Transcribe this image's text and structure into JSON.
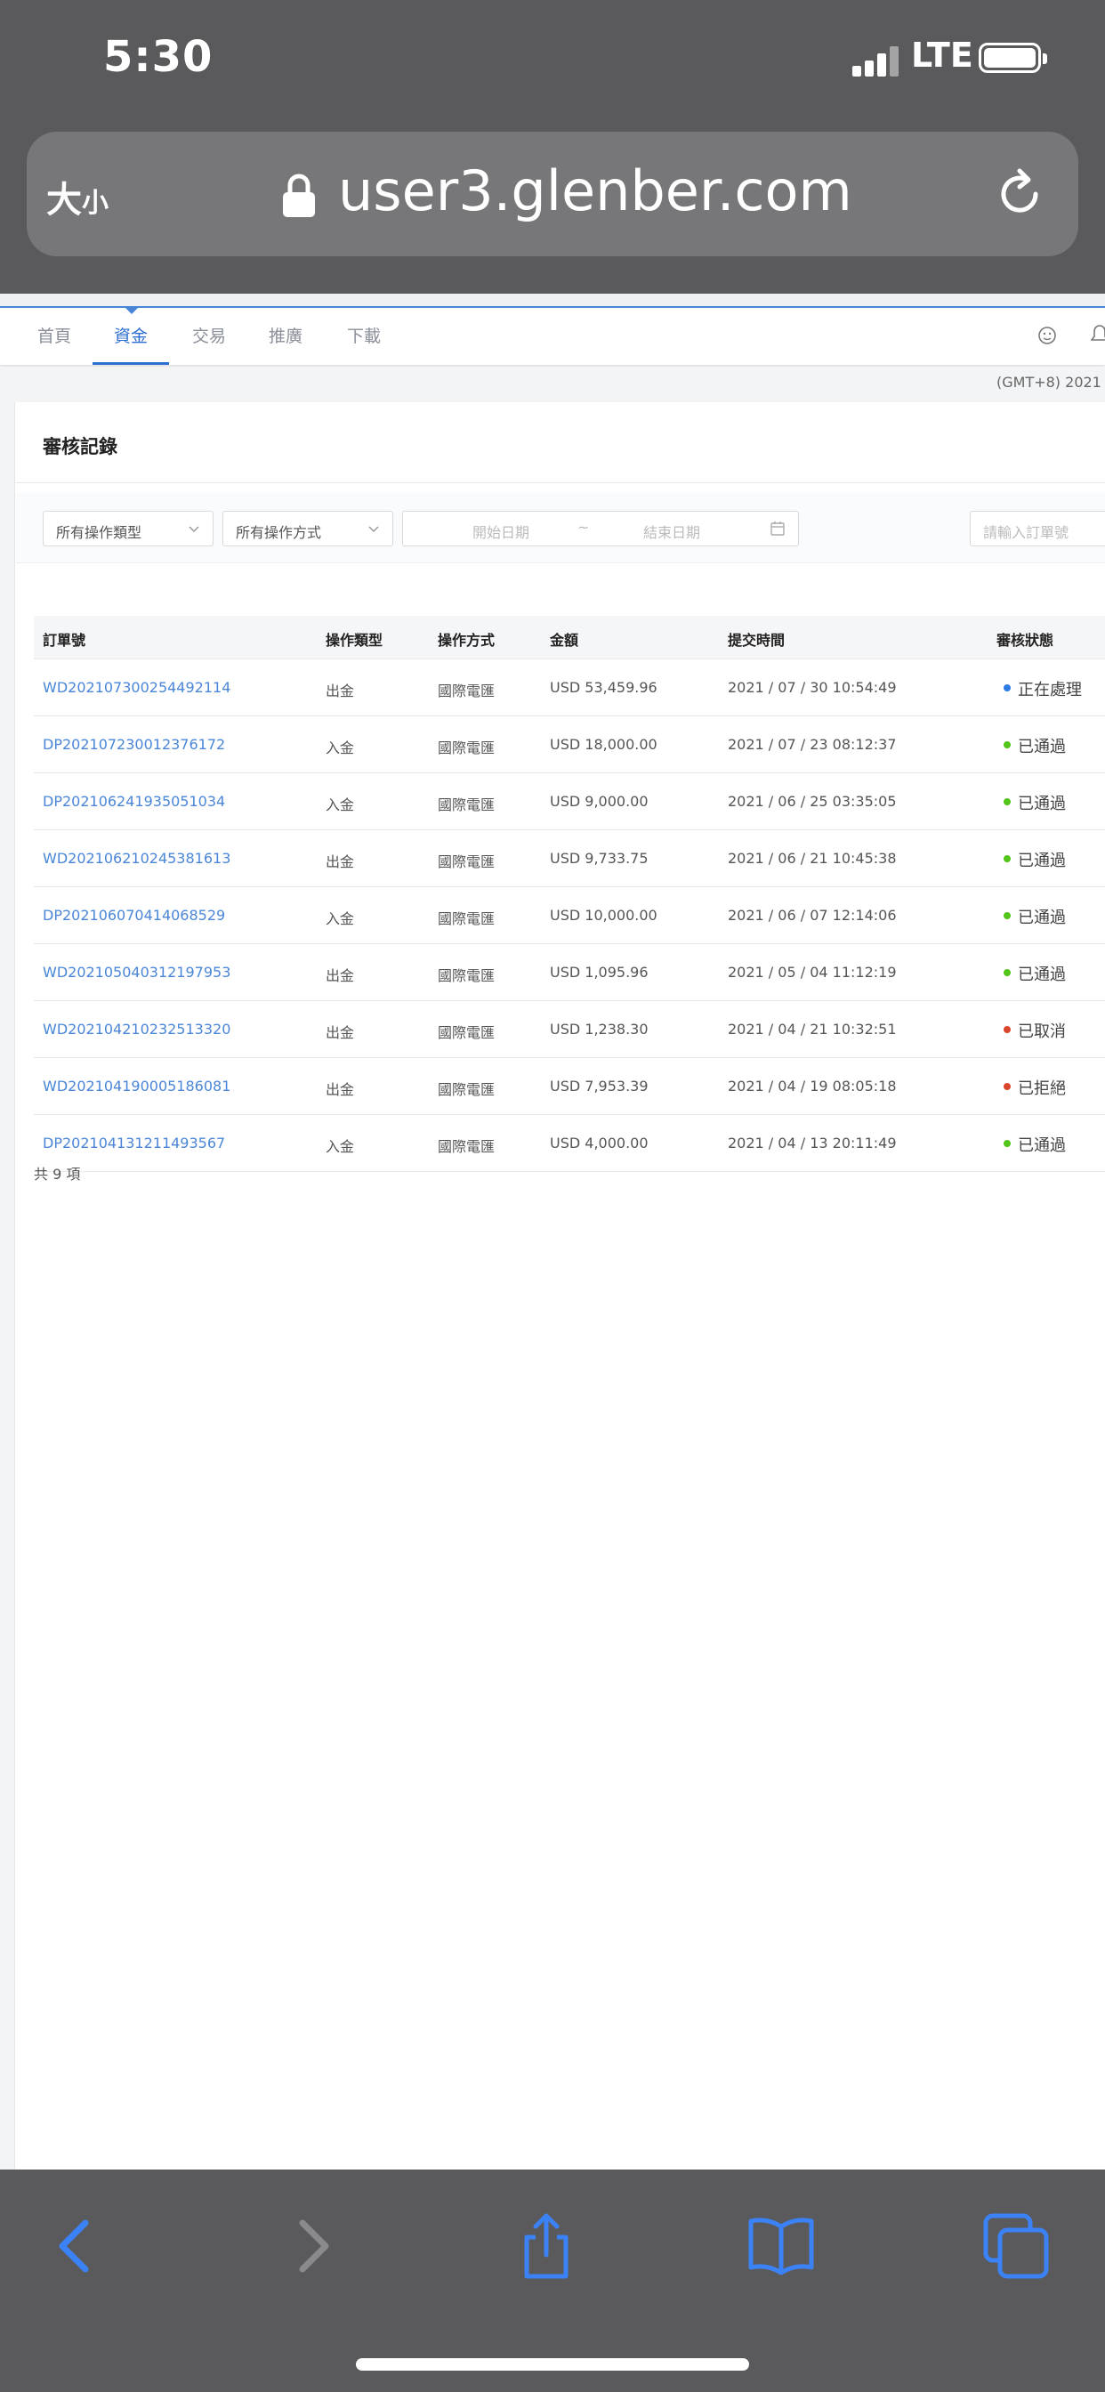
{
  "status_bar": {
    "time": "5:30",
    "network": "LTE"
  },
  "address_bar": {
    "text_size_big": "大",
    "text_size_small": "小",
    "domain": "user3.glenber.com"
  },
  "nav": {
    "tabs": [
      {
        "label": "首頁",
        "active": false
      },
      {
        "label": "資金",
        "active": true
      },
      {
        "label": "交易",
        "active": false
      },
      {
        "label": "推廣",
        "active": false
      },
      {
        "label": "下載",
        "active": false
      }
    ],
    "timezone": "(GMT+8) 2021 /"
  },
  "page": {
    "title": "審核記錄",
    "filters": {
      "type_select": "所有操作類型",
      "method_select": "所有操作方式",
      "start_date_placeholder": "開始日期",
      "date_separator": "~",
      "end_date_placeholder": "結束日期",
      "search_placeholder": "請輸入訂單號"
    },
    "table": {
      "headers": [
        "訂單號",
        "操作類型",
        "操作方式",
        "金額",
        "提交時間",
        "審核狀態"
      ],
      "rows": [
        {
          "order": "WD202107300254492114",
          "type": "出金",
          "method": "國際電匯",
          "amount": "USD 53,459.96",
          "time": "2021 / 07 / 30 10:54:49",
          "status": "正在處理",
          "status_color": "#2d7be5"
        },
        {
          "order": "DP202107230012376172",
          "type": "入金",
          "method": "國際電匯",
          "amount": "USD 18,000.00",
          "time": "2021 / 07 / 23 08:12:37",
          "status": "已通過",
          "status_color": "#52c41a"
        },
        {
          "order": "DP202106241935051034",
          "type": "入金",
          "method": "國際電匯",
          "amount": "USD 9,000.00",
          "time": "2021 / 06 / 25 03:35:05",
          "status": "已通過",
          "status_color": "#52c41a"
        },
        {
          "order": "WD202106210245381613",
          "type": "出金",
          "method": "國際電匯",
          "amount": "USD 9,733.75",
          "time": "2021 / 06 / 21 10:45:38",
          "status": "已通過",
          "status_color": "#52c41a"
        },
        {
          "order": "DP202106070414068529",
          "type": "入金",
          "method": "國際電匯",
          "amount": "USD 10,000.00",
          "time": "2021 / 06 / 07 12:14:06",
          "status": "已通過",
          "status_color": "#52c41a"
        },
        {
          "order": "WD202105040312197953",
          "type": "出金",
          "method": "國際電匯",
          "amount": "USD 1,095.96",
          "time": "2021 / 05 / 04 11:12:19",
          "status": "已通過",
          "status_color": "#52c41a"
        },
        {
          "order": "WD202104210232513320",
          "type": "出金",
          "method": "國際電匯",
          "amount": "USD 1,238.30",
          "time": "2021 / 04 / 21 10:32:51",
          "status": "已取消",
          "status_color": "#d9472b"
        },
        {
          "order": "WD202104190005186081",
          "type": "出金",
          "method": "國際電匯",
          "amount": "USD 7,953.39",
          "time": "2021 / 04 / 19 08:05:18",
          "status": "已拒絕",
          "status_color": "#d9472b"
        },
        {
          "order": "DP202104131211493567",
          "type": "入金",
          "method": "國際電匯",
          "amount": "USD 4,000.00",
          "time": "2021 / 04 / 13 20:11:49",
          "status": "已通過",
          "status_color": "#52c41a"
        }
      ],
      "total": "共 9 項"
    }
  },
  "colors": {
    "accent": "#4a86d8",
    "toolbar_icon": "#3b82f6",
    "chrome": "#5a5a5c"
  },
  "toolbar_icons": [
    "back-icon",
    "forward-icon",
    "share-icon",
    "bookmarks-icon",
    "tabs-icon"
  ]
}
